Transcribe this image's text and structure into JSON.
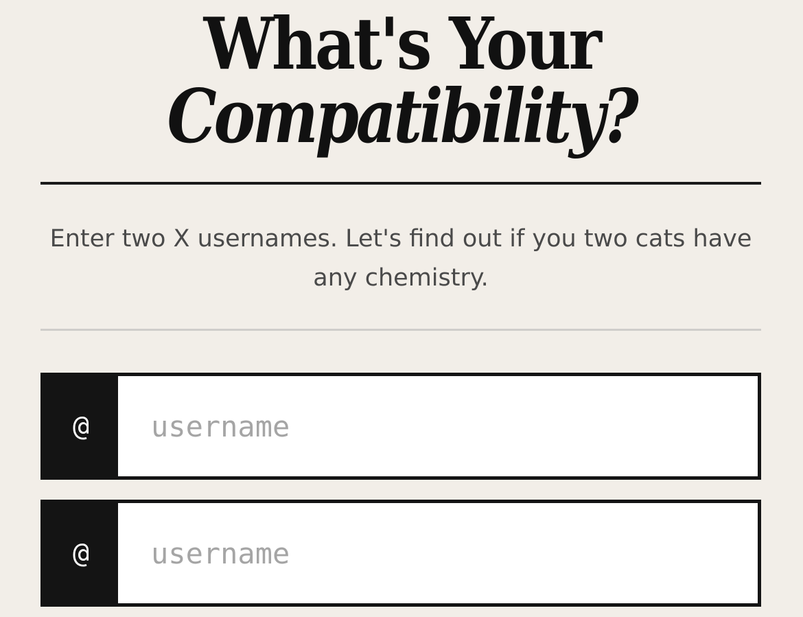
{
  "header": {
    "title_line1": "What's Your",
    "title_line2": "Compatibility?"
  },
  "intro": {
    "description": "Enter two X usernames. Let's find out if you two cats have any chemistry."
  },
  "form": {
    "fields": [
      {
        "prefix": "@",
        "placeholder": "username",
        "value": ""
      },
      {
        "prefix": "@",
        "placeholder": "username",
        "value": ""
      }
    ]
  },
  "colors": {
    "background": "#f2eee8",
    "ink": "#111111",
    "placeholder": "#a5a5a5",
    "divider_light": "#cfcdca"
  }
}
